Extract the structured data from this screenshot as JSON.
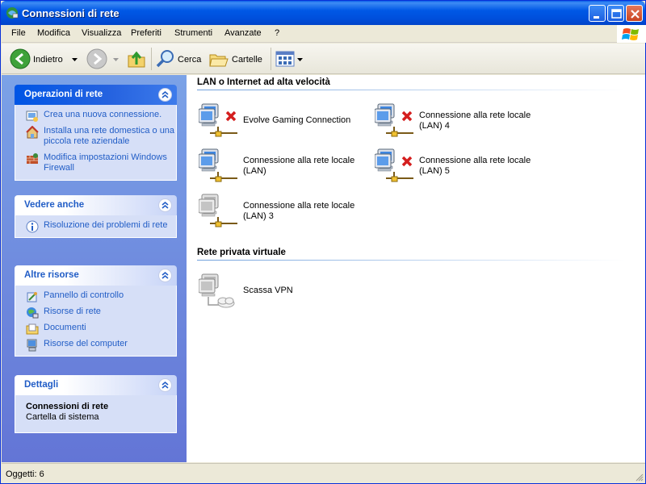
{
  "window": {
    "title": "Connessioni di rete"
  },
  "menu": [
    "File",
    "Modifica",
    "Visualizza",
    "Preferiti",
    "Strumenti",
    "Avanzate",
    "?"
  ],
  "toolbar": {
    "back": "Indietro",
    "search": "Cerca",
    "folders": "Cartelle"
  },
  "panels": {
    "network_tasks": {
      "title": "Operazioni di rete",
      "links": [
        {
          "label": "Crea una nuova connessione.",
          "icon": "new-connection-icon"
        },
        {
          "label": "Installa una rete domestica o una piccola rete aziendale",
          "icon": "home-network-icon"
        },
        {
          "label": "Modifica impostazioni Windows Firewall",
          "icon": "firewall-icon"
        }
      ]
    },
    "see_also": {
      "title": "Vedere anche",
      "links": [
        {
          "label": "Risoluzione dei problemi di rete",
          "icon": "info-icon"
        }
      ]
    },
    "other_places": {
      "title": "Altre risorse",
      "links": [
        {
          "label": "Pannello di controllo",
          "icon": "control-panel-icon"
        },
        {
          "label": "Risorse di rete",
          "icon": "network-places-icon"
        },
        {
          "label": "Documenti",
          "icon": "documents-icon"
        },
        {
          "label": "Risorse del computer",
          "icon": "my-computer-icon"
        }
      ]
    },
    "details": {
      "title": "Dettagli",
      "name": "Connessioni di rete",
      "type": "Cartella di sistema"
    }
  },
  "groups": {
    "lan": {
      "title": "LAN o Internet ad alta velocità",
      "items": [
        {
          "name": "Evolve Gaming Connection",
          "status": "disconnected"
        },
        {
          "name": "Connessione alla rete locale (LAN) 4",
          "status": "disconnected"
        },
        {
          "name": "Connessione alla rete locale (LAN)",
          "status": "connected"
        },
        {
          "name": "Connessione alla rete locale (LAN) 5",
          "status": "disconnected"
        },
        {
          "name": "Connessione alla rete locale (LAN) 3",
          "status": "disabled"
        }
      ]
    },
    "vpn": {
      "title": "Rete privata virtuale",
      "items": [
        {
          "name": "Scassa VPN",
          "status": "vpn"
        }
      ]
    }
  },
  "status": {
    "text": "Oggetti: 6"
  },
  "colors": {
    "titlebar": "#0058E6",
    "taskpane": "#6D8FE0",
    "link": "#215DC6",
    "panel_body": "#D6DFF7"
  }
}
